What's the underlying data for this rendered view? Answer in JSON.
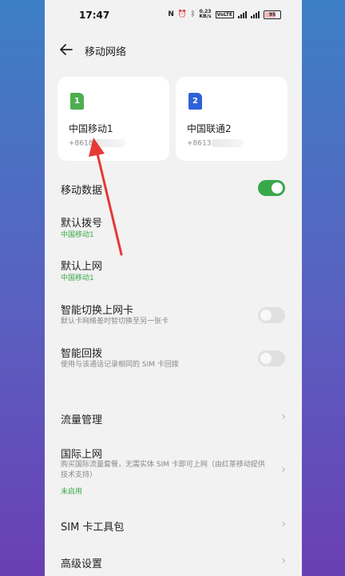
{
  "status_bar": {
    "time": "17:47",
    "nfc": "N",
    "alarm": "⏰",
    "bluetooth": "ᛒ",
    "speed_value": "0.23",
    "speed_unit": "KB/s",
    "network_type": "VoLTE",
    "battery": "95"
  },
  "header": {
    "title": "移动网络"
  },
  "sims": [
    {
      "slot": "1",
      "carrier": "中国移动1",
      "number": "+8618",
      "color": "#4caf50"
    },
    {
      "slot": "2",
      "carrier": "中国联通2",
      "number": "+8613",
      "color": "#2f62d8"
    }
  ],
  "settings": {
    "mobile_data": {
      "label": "移动数据",
      "enabled": true
    },
    "default_call": {
      "label": "默认拨号",
      "value": "中国移动1"
    },
    "default_internet": {
      "label": "默认上网",
      "value": "中国移动1"
    },
    "smart_switch": {
      "label": "智能切换上网卡",
      "desc": "默认卡网络差时智切换至另一张卡",
      "enabled": false
    },
    "smart_callback": {
      "label": "智能回拨",
      "desc": "使用与该通话记录相同的 SIM 卡回拨",
      "enabled": false
    },
    "data_management": {
      "label": "流量管理"
    },
    "international": {
      "label": "国际上网",
      "desc": "购买国际流量套餐，无需实体 SIM 卡即可上网（由红茶移动提供技术支持）",
      "status": "未启用"
    },
    "sim_toolkit": {
      "label": "SIM 卡工具包"
    },
    "advanced": {
      "label": "高级设置"
    }
  },
  "colors": {
    "accent": "#3aa84a",
    "annotation_arrow": "#e53935"
  }
}
